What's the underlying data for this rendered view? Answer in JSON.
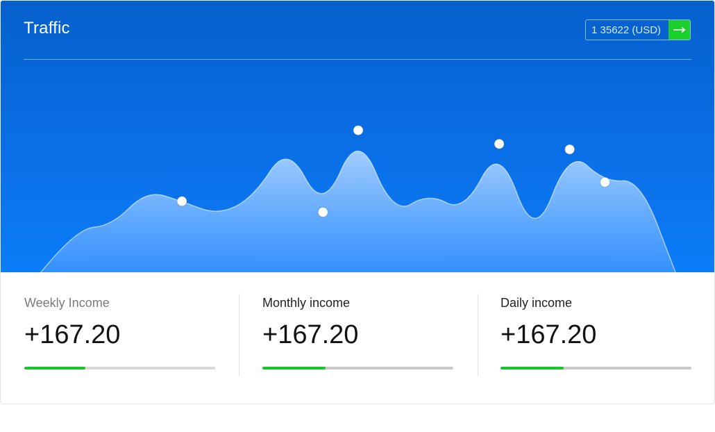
{
  "header": {
    "title": "Traffic",
    "total_value": "1 35622 (USD)",
    "go_icon": "arrow-right-icon"
  },
  "chart_data": {
    "type": "area",
    "title": "",
    "series": [
      {
        "values": [
          0,
          16,
          17,
          30,
          26,
          21,
          27,
          47,
          22,
          52,
          21,
          29,
          22,
          47,
          11,
          45,
          33,
          34,
          0
        ],
        "markers": [
          4,
          8,
          9,
          13,
          15,
          16
        ]
      }
    ],
    "ylim": [
      0,
      58
    ],
    "grid": false,
    "colors": {
      "fill_top": "#a9d2ff",
      "fill_bottom": "#3b94ff",
      "line": "#ffffff",
      "marker": "#ffffff"
    }
  },
  "stats": [
    {
      "label": "Weekly Income",
      "value": "+167.20",
      "progress": 0.32
    },
    {
      "label": "Monthly income",
      "value": "+167.20",
      "progress": 0.33
    },
    {
      "label": "Daily income",
      "value": "+167.20",
      "progress": 0.33
    }
  ],
  "colors": {
    "accent": "#17c62a",
    "hero": "#0a6fe6"
  }
}
